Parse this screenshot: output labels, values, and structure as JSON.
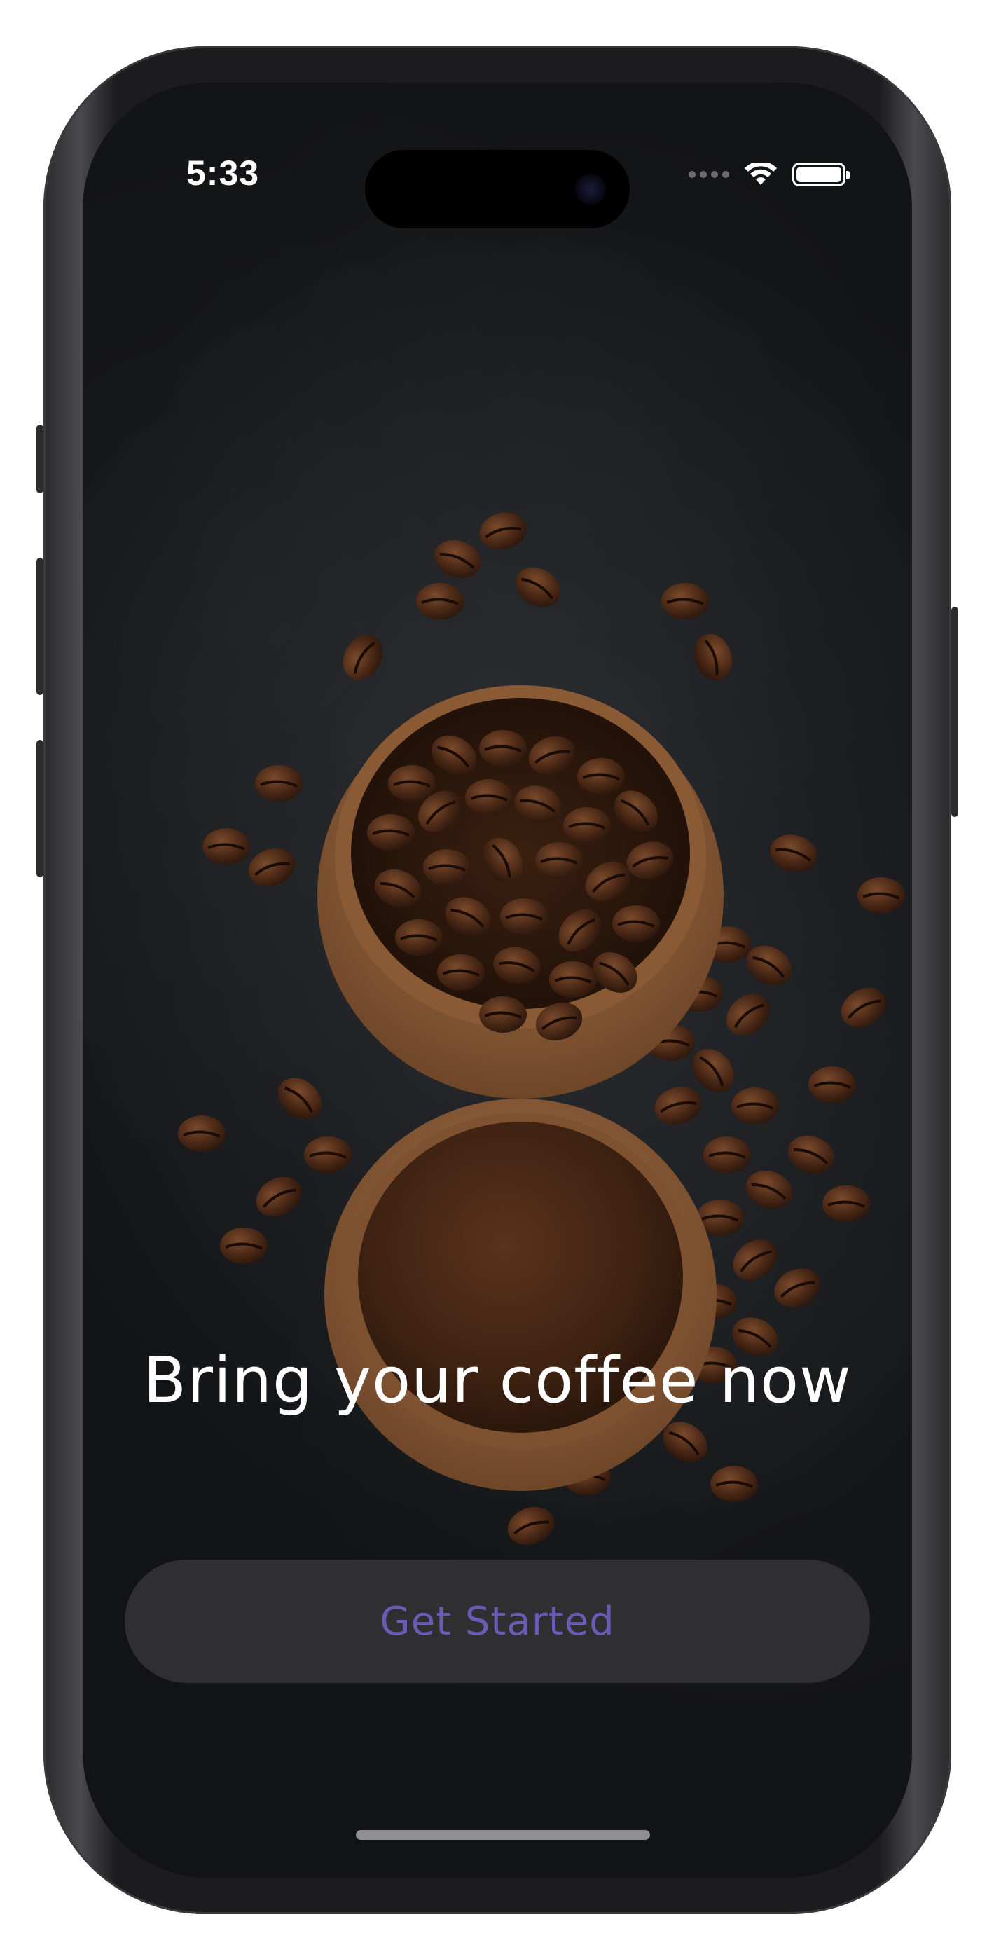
{
  "status_bar": {
    "time": "5:33"
  },
  "icons": {
    "signal": "cellular-signal-icon",
    "wifi": "wifi-icon",
    "battery": "battery-icon"
  },
  "hero": {
    "image": "coffee-beans-bowls-image"
  },
  "onboarding": {
    "headline": "Bring your coffee now",
    "cta_label": "Get Started"
  },
  "colors": {
    "background": "#1a1b1e",
    "cta_background": "#2f2e30",
    "cta_text": "#6b5bb5",
    "headline_text": "#ffffff"
  }
}
